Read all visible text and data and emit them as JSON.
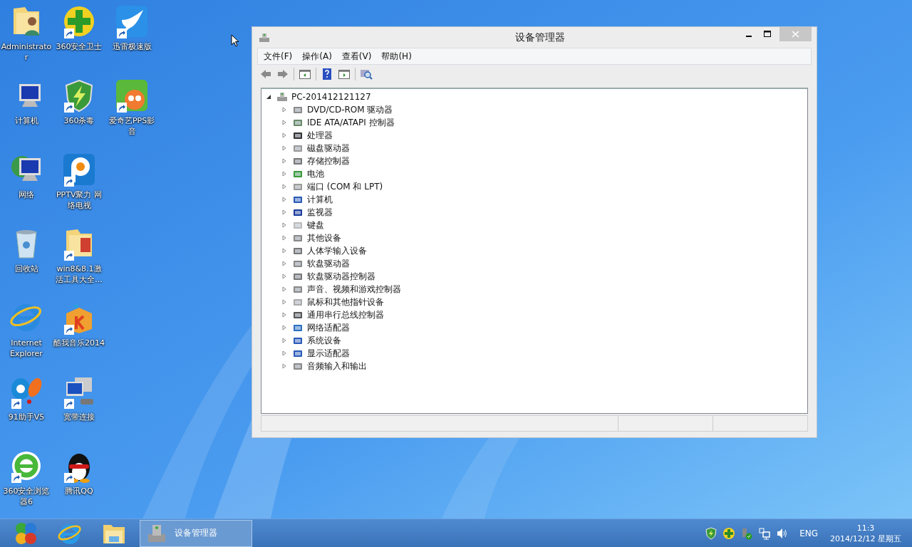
{
  "desktop_columns": [
    [
      {
        "label": "Administrator"
      },
      {
        "label": "计算机"
      },
      {
        "label": "网络"
      },
      {
        "label": "回收站"
      },
      {
        "label": "Internet Explorer"
      },
      {
        "label": "91助手V5",
        "shortcut": true
      },
      {
        "label": "360安全浏览器6",
        "shortcut": true
      }
    ],
    [
      {
        "label": "360安全卫士",
        "shortcut": true
      },
      {
        "label": "360杀毒",
        "shortcut": true
      },
      {
        "label": "PPTV聚力 网络电视",
        "shortcut": true
      },
      {
        "label": "win8&8.1激活工具大全...",
        "shortcut": true
      },
      {
        "label": "酷我音乐2014",
        "shortcut": true
      },
      {
        "label": "宽带连接",
        "shortcut": true
      },
      {
        "label": "腾讯QQ",
        "shortcut": true
      }
    ],
    [
      {
        "label": "迅雷极速版",
        "shortcut": true
      },
      {
        "label": "爱奇艺PPS影音",
        "shortcut": true
      }
    ]
  ],
  "window": {
    "title": "设备管理器",
    "menu": [
      "文件(F)",
      "操作(A)",
      "查看(V)",
      "帮助(H)"
    ],
    "tree": {
      "label": "PC-201412121127",
      "expanded": true,
      "children": [
        {
          "label": "DVD/CD-ROM 驱动器",
          "expanded": false
        },
        {
          "label": "IDE ATA/ATAPI 控制器",
          "expanded": false
        },
        {
          "label": "处理器",
          "expanded": false
        },
        {
          "label": "磁盘驱动器",
          "expanded": false
        },
        {
          "label": "存储控制器",
          "expanded": false
        },
        {
          "label": "电池",
          "expanded": false
        },
        {
          "label": "端口 (COM 和 LPT)",
          "expanded": false
        },
        {
          "label": "计算机",
          "expanded": false
        },
        {
          "label": "监视器",
          "expanded": false
        },
        {
          "label": "键盘",
          "expanded": false
        },
        {
          "label": "其他设备",
          "expanded": false
        },
        {
          "label": "人体学输入设备",
          "expanded": false
        },
        {
          "label": "软盘驱动器",
          "expanded": false
        },
        {
          "label": "软盘驱动器控制器",
          "expanded": false
        },
        {
          "label": "声音、视频和游戏控制器",
          "expanded": false
        },
        {
          "label": "鼠标和其他指针设备",
          "expanded": false
        },
        {
          "label": "通用串行总线控制器",
          "expanded": false
        },
        {
          "label": "网络适配器",
          "expanded": false
        },
        {
          "label": "系统设备",
          "expanded": false
        },
        {
          "label": "显示适配器",
          "expanded": false
        },
        {
          "label": "音频输入和输出",
          "expanded": false
        }
      ]
    }
  },
  "taskbar": {
    "task": {
      "label": "设备管理器",
      "selected": true
    },
    "language": "ENG",
    "time": "11:3",
    "date": "2014/12/12 星期五"
  }
}
